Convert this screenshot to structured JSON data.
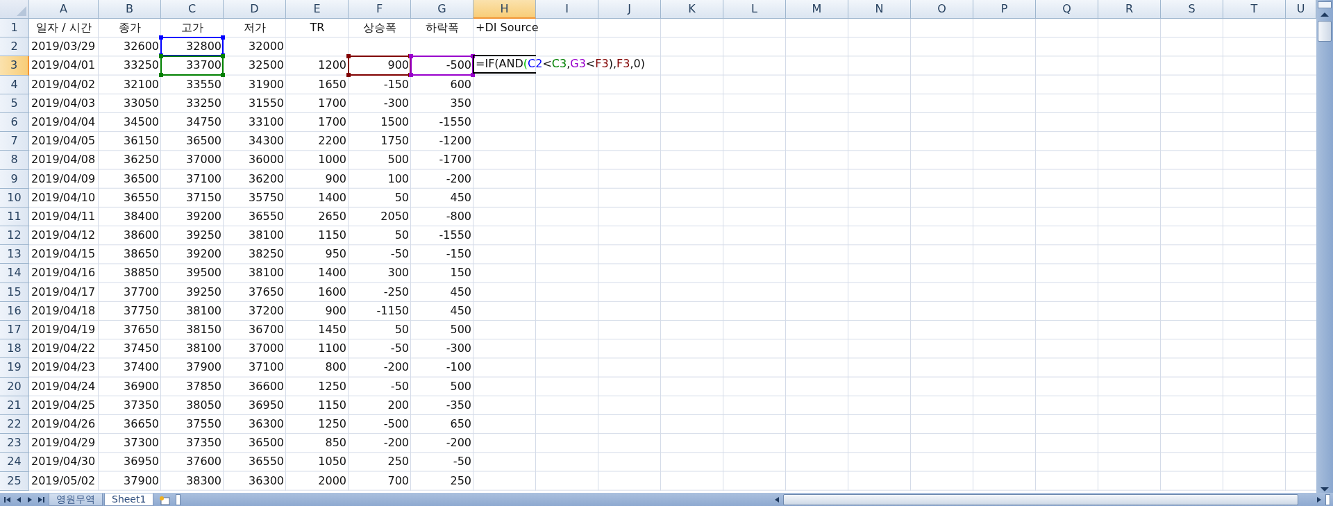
{
  "columns": [
    {
      "label": "A",
      "selected": false
    },
    {
      "label": "B",
      "selected": false
    },
    {
      "label": "C",
      "selected": false
    },
    {
      "label": "D",
      "selected": false
    },
    {
      "label": "E",
      "selected": false
    },
    {
      "label": "F",
      "selected": false
    },
    {
      "label": "G",
      "selected": false
    },
    {
      "label": "H",
      "selected": true
    },
    {
      "label": "I",
      "selected": false
    },
    {
      "label": "J",
      "selected": false
    },
    {
      "label": "K",
      "selected": false
    },
    {
      "label": "L",
      "selected": false
    },
    {
      "label": "M",
      "selected": false
    },
    {
      "label": "N",
      "selected": false
    },
    {
      "label": "O",
      "selected": false
    },
    {
      "label": "P",
      "selected": false
    },
    {
      "label": "Q",
      "selected": false
    },
    {
      "label": "R",
      "selected": false
    },
    {
      "label": "S",
      "selected": false
    },
    {
      "label": "T",
      "selected": false
    },
    {
      "label": "U",
      "selected": false
    }
  ],
  "rows": [
    {
      "number": "1",
      "selected": false,
      "kind": "header",
      "cells": [
        "일자 / 시간",
        "종가",
        "고가",
        "저가",
        "TR",
        "상승폭",
        "하락폭",
        "+DI Source"
      ]
    },
    {
      "number": "2",
      "selected": false,
      "cells": [
        "2019/03/29",
        "32600",
        {
          "text": "32800",
          "color": "#0000ff"
        },
        "32000"
      ]
    },
    {
      "number": "3",
      "selected": true,
      "cells": [
        "2019/04/01",
        "33250",
        {
          "text": "33700",
          "color": "#008000"
        },
        "32500",
        "1200",
        {
          "text": "900",
          "color": "#800000"
        },
        {
          "text": "-500",
          "color": "#9900cc"
        }
      ],
      "editor": [
        {
          "text": "=IF(AND"
        },
        {
          "text": "(",
          "color": "#00c000"
        },
        {
          "text": "C2",
          "color": "#0000ff"
        },
        {
          "text": "<"
        },
        {
          "text": "C3",
          "color": "#008000"
        },
        {
          "text": ","
        },
        {
          "text": "G3",
          "color": "#9900cc"
        },
        {
          "text": "<"
        },
        {
          "text": "F3",
          "color": "#800000"
        },
        {
          "text": "),"
        },
        {
          "text": "F3",
          "color": "#800000"
        },
        {
          "text": ",0)"
        }
      ]
    },
    {
      "number": "4",
      "selected": false,
      "cells": [
        "2019/04/02",
        "32100",
        "33550",
        "31900",
        "1650",
        "-150",
        "600"
      ]
    },
    {
      "number": "5",
      "selected": false,
      "cells": [
        "2019/04/03",
        "33050",
        "33250",
        "31550",
        "1700",
        "-300",
        "350"
      ]
    },
    {
      "number": "6",
      "selected": false,
      "cells": [
        "2019/04/04",
        "34500",
        "34750",
        "33100",
        "1700",
        "1500",
        "-1550"
      ]
    },
    {
      "number": "7",
      "selected": false,
      "cells": [
        "2019/04/05",
        "36150",
        "36500",
        "34300",
        "2200",
        "1750",
        "-1200"
      ]
    },
    {
      "number": "8",
      "selected": false,
      "cells": [
        "2019/04/08",
        "36250",
        "37000",
        "36000",
        "1000",
        "500",
        "-1700"
      ]
    },
    {
      "number": "9",
      "selected": false,
      "cells": [
        "2019/04/09",
        "36500",
        "37100",
        "36200",
        "900",
        "100",
        "-200"
      ]
    },
    {
      "number": "10",
      "selected": false,
      "cells": [
        "2019/04/10",
        "36550",
        "37150",
        "35750",
        "1400",
        "50",
        "450"
      ]
    },
    {
      "number": "11",
      "selected": false,
      "cells": [
        "2019/04/11",
        "38400",
        "39200",
        "36550",
        "2650",
        "2050",
        "-800"
      ]
    },
    {
      "number": "12",
      "selected": false,
      "cells": [
        "2019/04/12",
        "38600",
        "39250",
        "38100",
        "1150",
        "50",
        "-1550"
      ]
    },
    {
      "number": "13",
      "selected": false,
      "cells": [
        "2019/04/15",
        "38650",
        "39200",
        "38250",
        "950",
        "-50",
        "-150"
      ]
    },
    {
      "number": "14",
      "selected": false,
      "cells": [
        "2019/04/16",
        "38850",
        "39500",
        "38100",
        "1400",
        "300",
        "150"
      ]
    },
    {
      "number": "15",
      "selected": false,
      "cells": [
        "2019/04/17",
        "37700",
        "39250",
        "37650",
        "1600",
        "-250",
        "450"
      ]
    },
    {
      "number": "16",
      "selected": false,
      "cells": [
        "2019/04/18",
        "37750",
        "38100",
        "37200",
        "900",
        "-1150",
        "450"
      ]
    },
    {
      "number": "17",
      "selected": false,
      "cells": [
        "2019/04/19",
        "37650",
        "38150",
        "36700",
        "1450",
        "50",
        "500"
      ]
    },
    {
      "number": "18",
      "selected": false,
      "cells": [
        "2019/04/22",
        "37450",
        "38100",
        "37000",
        "1100",
        "-50",
        "-300"
      ]
    },
    {
      "number": "19",
      "selected": false,
      "cells": [
        "2019/04/23",
        "37400",
        "37900",
        "37100",
        "800",
        "-200",
        "-100"
      ]
    },
    {
      "number": "20",
      "selected": false,
      "cells": [
        "2019/04/24",
        "36900",
        "37850",
        "36600",
        "1250",
        "-50",
        "500"
      ]
    },
    {
      "number": "21",
      "selected": false,
      "cells": [
        "2019/04/25",
        "37350",
        "38050",
        "36950",
        "1150",
        "200",
        "-350"
      ]
    },
    {
      "number": "22",
      "selected": false,
      "cells": [
        "2019/04/26",
        "36650",
        "37550",
        "36300",
        "1250",
        "-500",
        "650"
      ]
    },
    {
      "number": "23",
      "selected": false,
      "cells": [
        "2019/04/29",
        "37300",
        "37350",
        "36500",
        "850",
        "-200",
        "-200"
      ]
    },
    {
      "number": "24",
      "selected": false,
      "cells": [
        "2019/04/30",
        "36950",
        "37600",
        "36550",
        "1050",
        "250",
        "-50"
      ]
    },
    {
      "number": "25",
      "selected": false,
      "cells": [
        "2019/05/02",
        "37900",
        "38300",
        "36300",
        "2000",
        "700",
        "250"
      ]
    }
  ],
  "sheet_tabs": [
    {
      "label": "영원무역",
      "selected": false
    },
    {
      "label": "Sheet1",
      "selected": true
    }
  ]
}
